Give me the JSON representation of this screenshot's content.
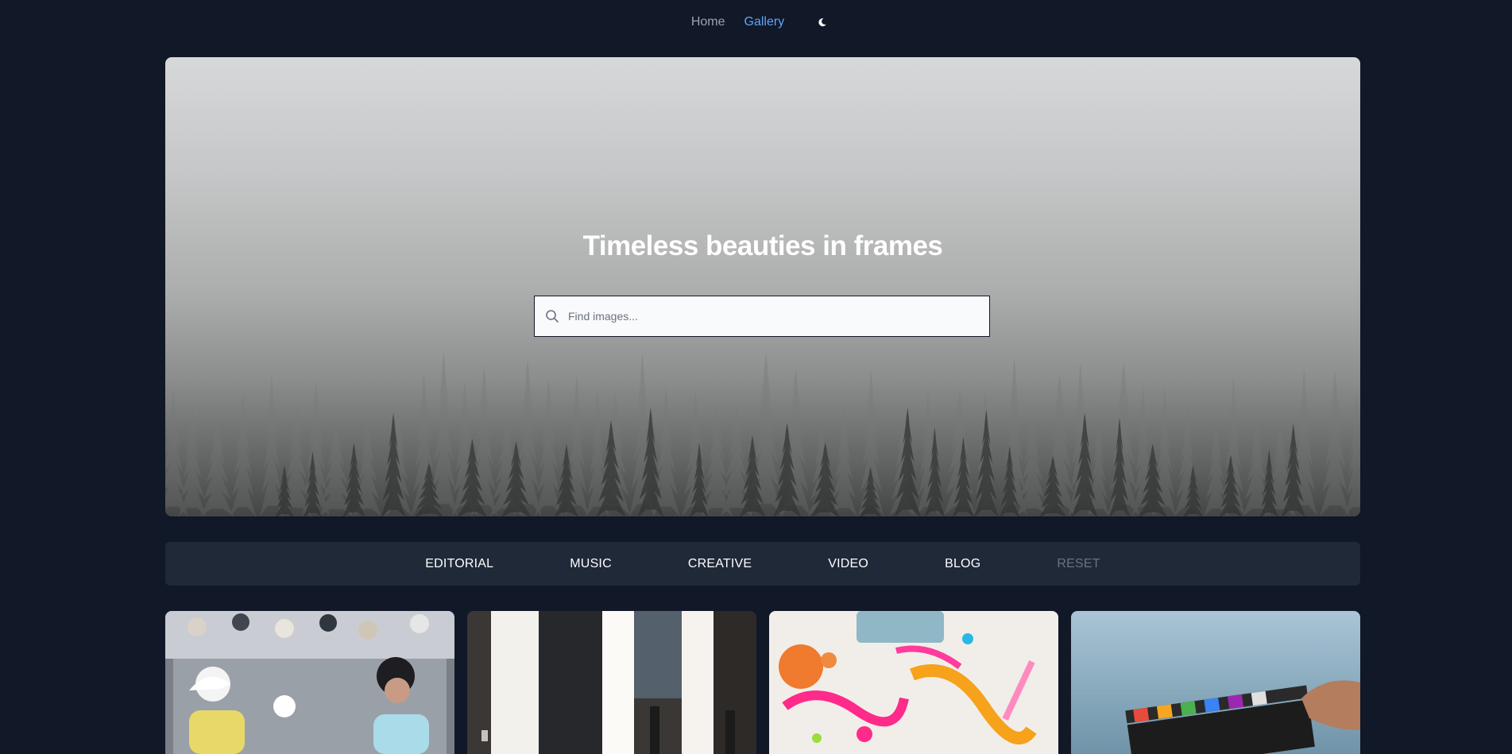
{
  "nav": {
    "home_label": "Home",
    "gallery_label": "Gallery",
    "theme_icon": "moon-icon",
    "active_color": "#60a5fa"
  },
  "hero": {
    "title": "Timeless beauties in frames",
    "search": {
      "placeholder": "Find images...",
      "value": "",
      "icon": "search-icon"
    }
  },
  "filters": {
    "items": [
      "EDITORIAL",
      "MUSIC",
      "CREATIVE",
      "VIDEO",
      "BLOG"
    ],
    "reset_label": "RESET"
  },
  "gallery": {
    "cards": [
      {
        "subject": "tennis-players-crowd"
      },
      {
        "subject": "music-studio-guitars"
      },
      {
        "subject": "colorful-paint-splatter"
      },
      {
        "subject": "film-clapperboard-sky"
      }
    ]
  },
  "colors": {
    "background": "#111827",
    "filter_bar": "#1f2937",
    "muted_text": "#6b7280"
  }
}
